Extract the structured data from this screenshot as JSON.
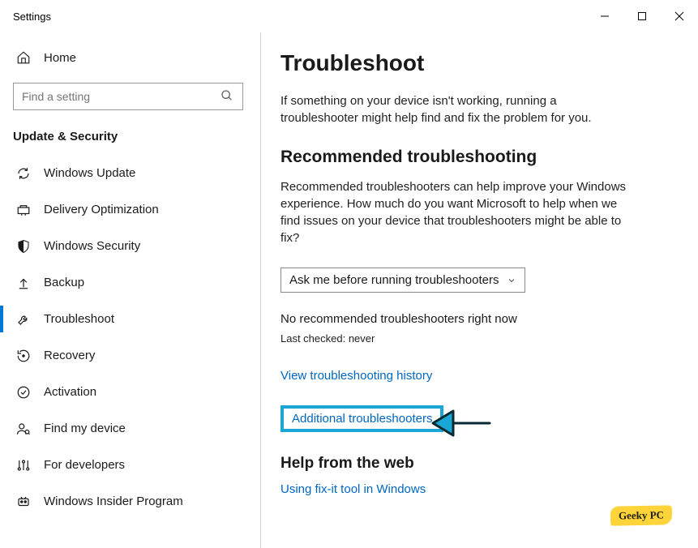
{
  "window": {
    "title": "Settings"
  },
  "sidebar": {
    "home": "Home",
    "search_placeholder": "Find a setting",
    "section": "Update & Security",
    "items": [
      {
        "label": "Windows Update"
      },
      {
        "label": "Delivery Optimization"
      },
      {
        "label": "Windows Security"
      },
      {
        "label": "Backup"
      },
      {
        "label": "Troubleshoot"
      },
      {
        "label": "Recovery"
      },
      {
        "label": "Activation"
      },
      {
        "label": "Find my device"
      },
      {
        "label": "For developers"
      },
      {
        "label": "Windows Insider Program"
      }
    ]
  },
  "main": {
    "title": "Troubleshoot",
    "intro": "If something on your device isn't working, running a troubleshooter might help find and fix the problem for you.",
    "rec_heading": "Recommended troubleshooting",
    "rec_desc": "Recommended troubleshooters can help improve your Windows experience. How much do you want Microsoft to help when we find issues on your device that troubleshooters might be able to fix?",
    "dropdown_value": "Ask me before running troubleshooters",
    "no_rec": "No recommended troubleshooters right now",
    "last_checked": "Last checked: never",
    "history_link": "View troubleshooting history",
    "additional_link": "Additional troubleshooters",
    "help_heading": "Help from the web",
    "fixit_link": "Using fix-it tool in Windows"
  },
  "watermark": "Geeky PC"
}
